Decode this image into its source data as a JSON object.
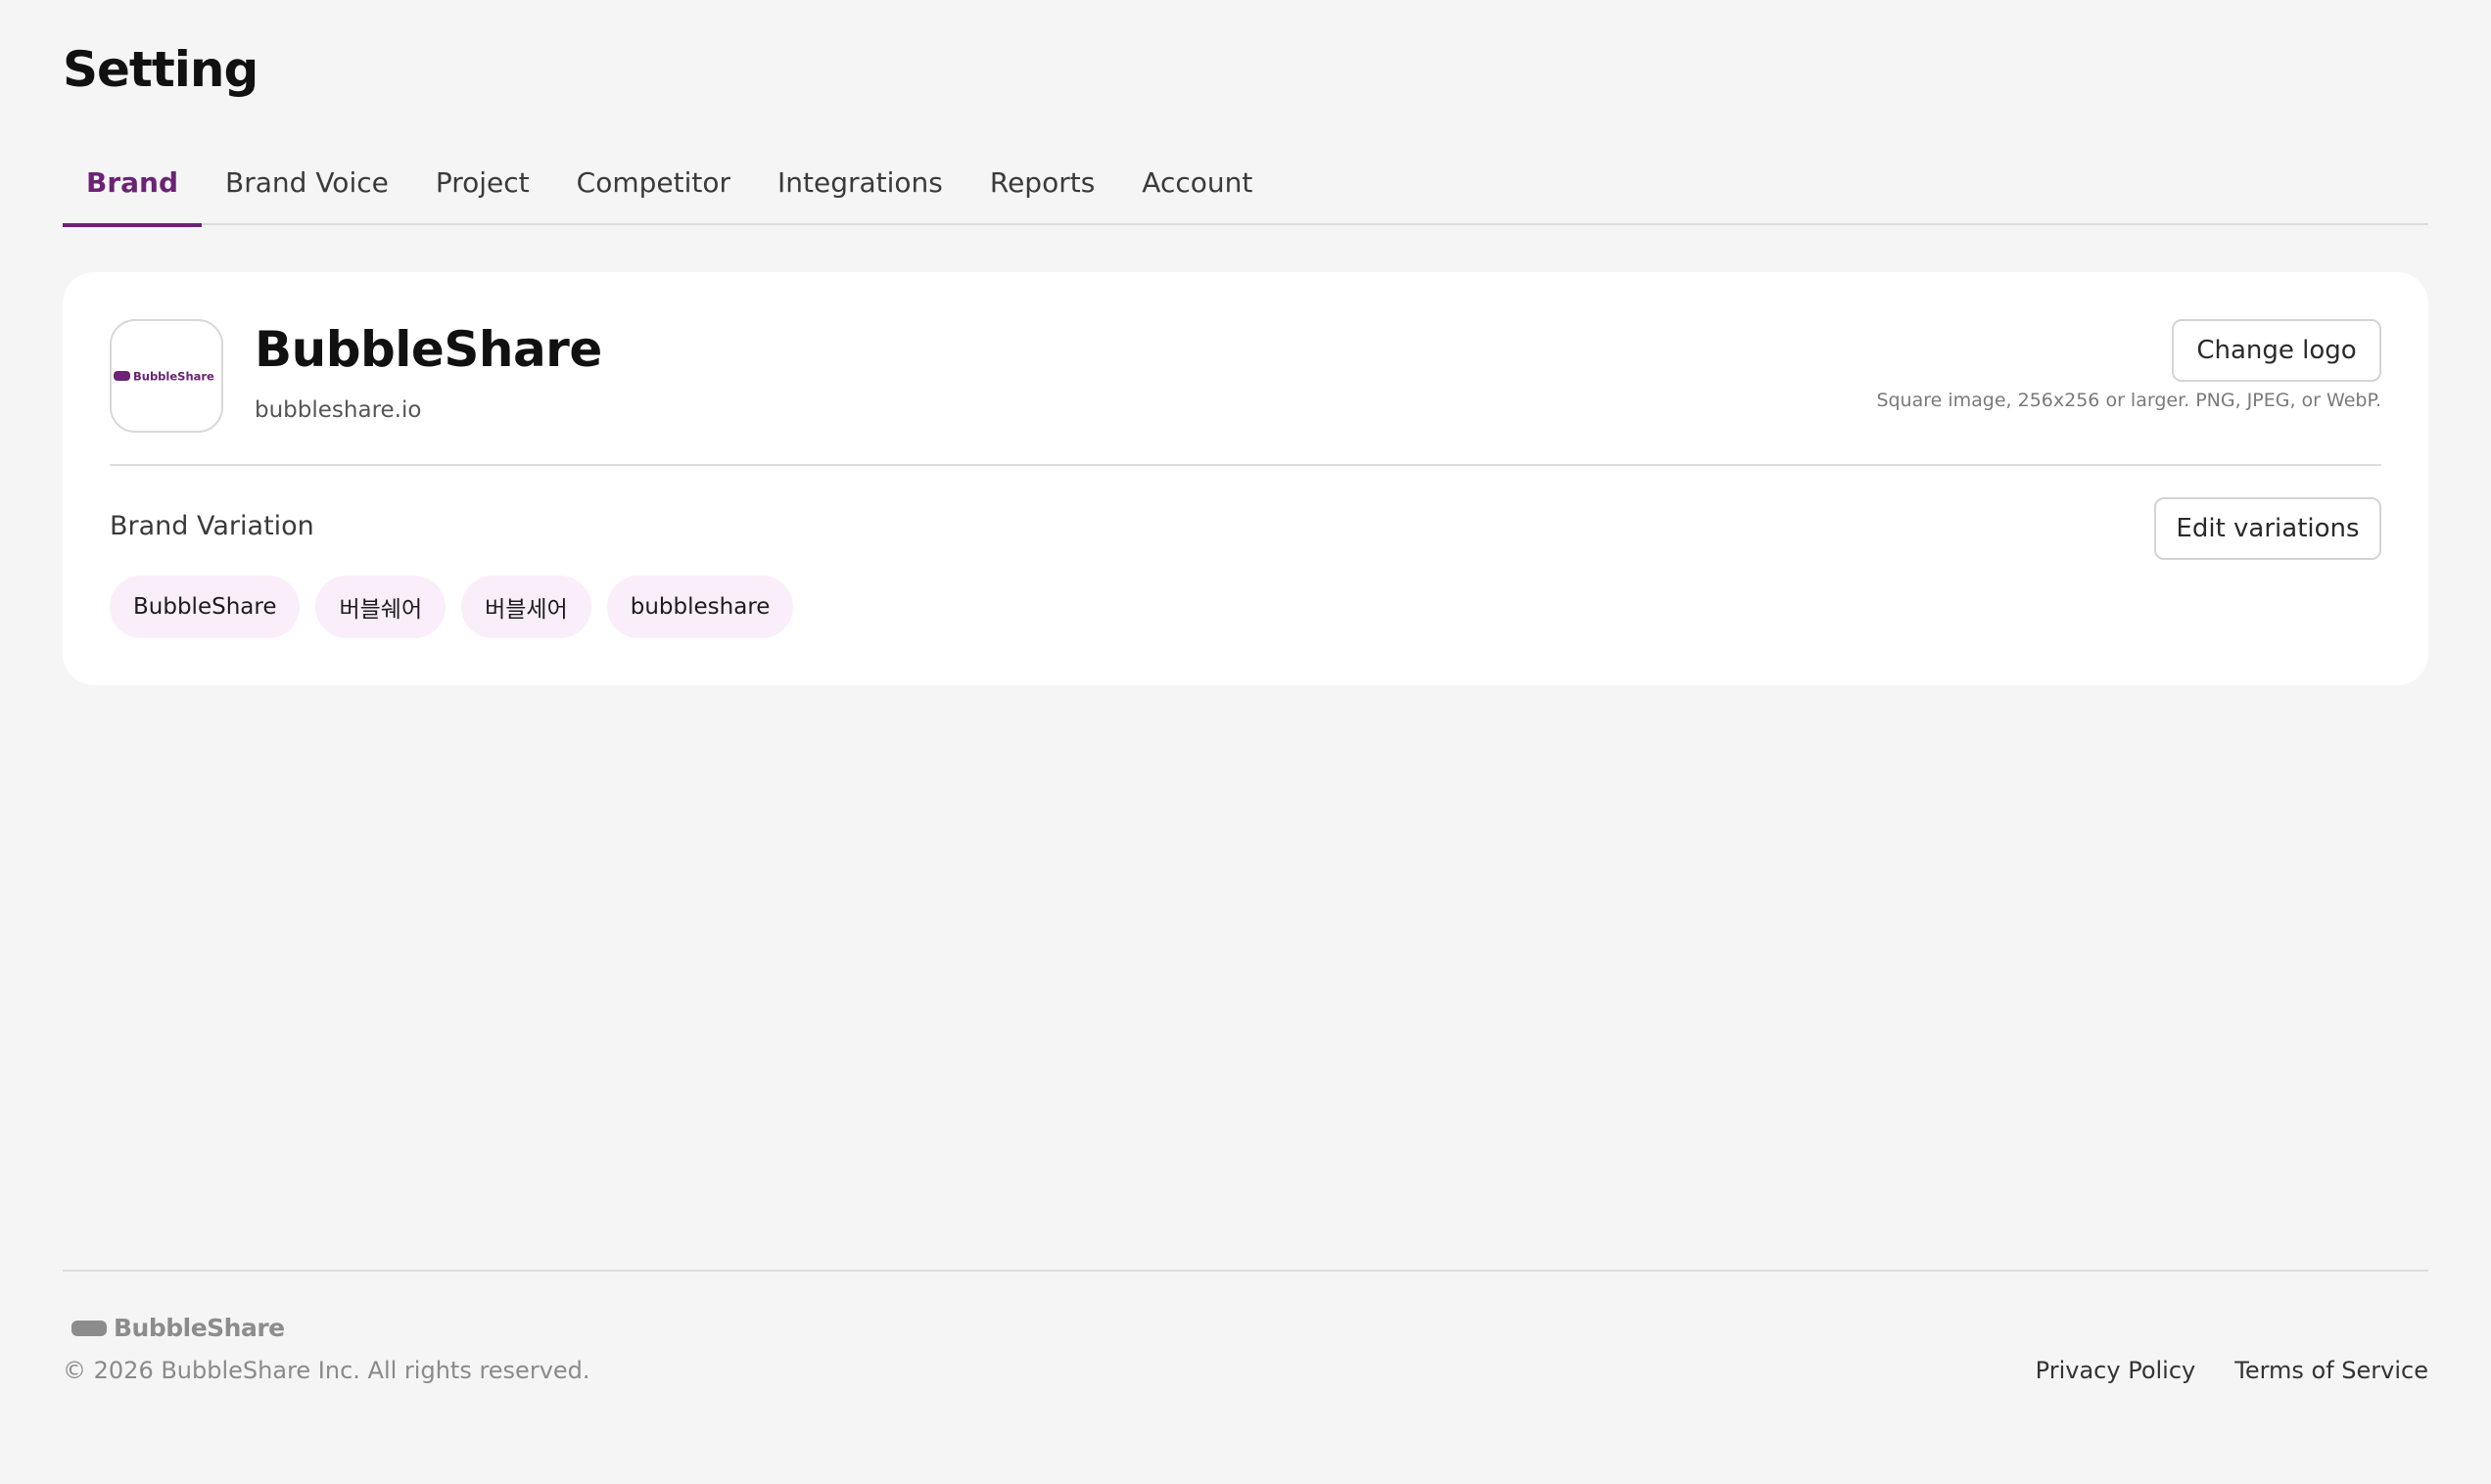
{
  "page": {
    "title": "Setting"
  },
  "tabs": [
    {
      "label": "Brand",
      "active": true
    },
    {
      "label": "Brand Voice",
      "active": false
    },
    {
      "label": "Project",
      "active": false
    },
    {
      "label": "Competitor",
      "active": false
    },
    {
      "label": "Integrations",
      "active": false
    },
    {
      "label": "Reports",
      "active": false
    },
    {
      "label": "Account",
      "active": false
    }
  ],
  "brand": {
    "logo_text": "BubbleShare",
    "name": "BubbleShare",
    "domain": "bubbleshare.io",
    "change_logo_label": "Change logo",
    "logo_hint": "Square image, 256x256 or larger. PNG, JPEG, or WebP."
  },
  "variations": {
    "label": "Brand Variation",
    "edit_label": "Edit variations",
    "items": [
      "BubbleShare",
      "버블쉐어",
      "버블세어",
      "bubbleshare"
    ]
  },
  "footer": {
    "logo_text": "BubbleShare",
    "copyright": "© 2026 BubbleShare Inc. All rights reserved.",
    "links": [
      "Privacy Policy",
      "Terms of Service"
    ]
  },
  "colors": {
    "accent": "#6b2374",
    "chip_background": "#fbeefb",
    "page_background": "#f5f5f5"
  }
}
